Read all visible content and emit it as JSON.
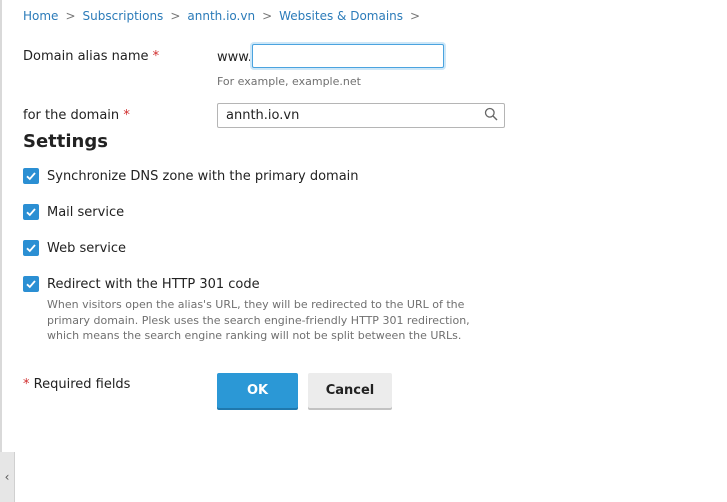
{
  "breadcrumb": {
    "items": [
      "Home",
      "Subscriptions",
      "annth.io.vn",
      "Websites & Domains"
    ],
    "separator": ">"
  },
  "form": {
    "alias_label": "Domain alias name",
    "required_mark": "*",
    "www_prefix": "www.",
    "alias_value": "",
    "alias_hint": "For example, example.net",
    "domain_label": "for the domain",
    "domain_value": "annth.io.vn"
  },
  "settings": {
    "title": "Settings",
    "options": [
      {
        "label": "Synchronize DNS zone with the primary domain",
        "checked": true
      },
      {
        "label": "Mail service",
        "checked": true
      },
      {
        "label": "Web service",
        "checked": true
      },
      {
        "label": "Redirect with the HTTP 301 code",
        "checked": true
      }
    ],
    "redirect_description": "When visitors open the alias's URL, they will be redirected to the URL of the primary domain. Plesk uses the search engine-friendly HTTP 301 redirection, which means the search engine ranking will not be split between the URLs."
  },
  "footer": {
    "required_mark": "*",
    "required_note": "Required fields",
    "ok_label": "OK",
    "cancel_label": "Cancel"
  },
  "colors": {
    "link": "#2b7bb9",
    "accent": "#2b98d6",
    "required": "#d02c2c",
    "hint": "#707070"
  },
  "icons": {
    "search": "magnifier-icon",
    "collapse": "chevron-left-icon",
    "check": "checkmark-icon"
  }
}
